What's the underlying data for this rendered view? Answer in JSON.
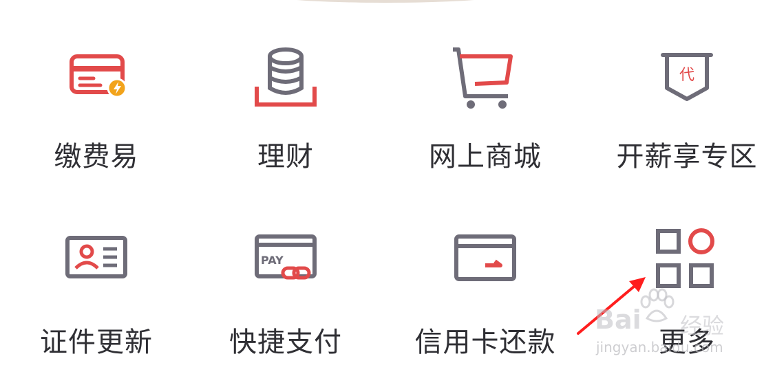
{
  "menu": {
    "items": [
      {
        "label": "缴费易",
        "icon": "bill-payment-card-icon"
      },
      {
        "label": "理财",
        "icon": "coin-stack-icon"
      },
      {
        "label": "网上商城",
        "icon": "shopping-cart-icon"
      },
      {
        "label": "开薪享专区",
        "icon": "salary-badge-icon"
      },
      {
        "label": "证件更新",
        "icon": "id-card-icon"
      },
      {
        "label": "快捷支付",
        "icon": "pay-card-link-icon"
      },
      {
        "label": "信用卡还款",
        "icon": "credit-card-repay-icon"
      },
      {
        "label": "更多",
        "icon": "more-apps-grid-icon"
      }
    ]
  },
  "icons": {
    "badge_char": "代",
    "pay_text": "PAY"
  },
  "watermark": {
    "brand": "Bai",
    "brand_suffix": "经验",
    "url": "jingyan.baidu.com"
  },
  "colors": {
    "accent_red": "#e24a4a",
    "icon_gray": "#6e6c78",
    "label_text": "#2f2f34",
    "annotation_arrow": "#ff1e1e",
    "lightning_orange": "#f2a31b"
  }
}
